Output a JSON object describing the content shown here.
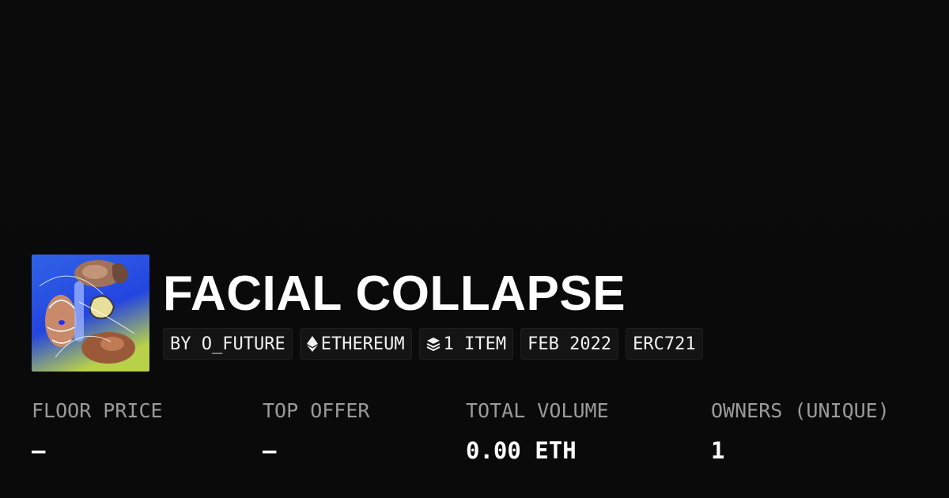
{
  "collection": {
    "title": "FACIAL COLLAPSE",
    "thumbnail_icon": "collection-artwork"
  },
  "tags": [
    {
      "label": "BY O_FUTURE"
    },
    {
      "label": "ETHEREUM",
      "icon": "ethereum-icon"
    },
    {
      "label": "1 ITEM",
      "icon": "layers-icon"
    },
    {
      "label": "FEB 2022"
    },
    {
      "label": "ERC721"
    }
  ],
  "stats": [
    {
      "label": "FLOOR PRICE",
      "value": "–"
    },
    {
      "label": "TOP OFFER",
      "value": "–"
    },
    {
      "label": "TOTAL VOLUME",
      "value": "0.00 ETH"
    },
    {
      "label": "OWNERS (UNIQUE)",
      "value": "1"
    }
  ],
  "colors": {
    "background": "#0b0b0b",
    "text": "#ffffff",
    "muted": "#9a9a9a",
    "tag_bg": "#141414"
  }
}
